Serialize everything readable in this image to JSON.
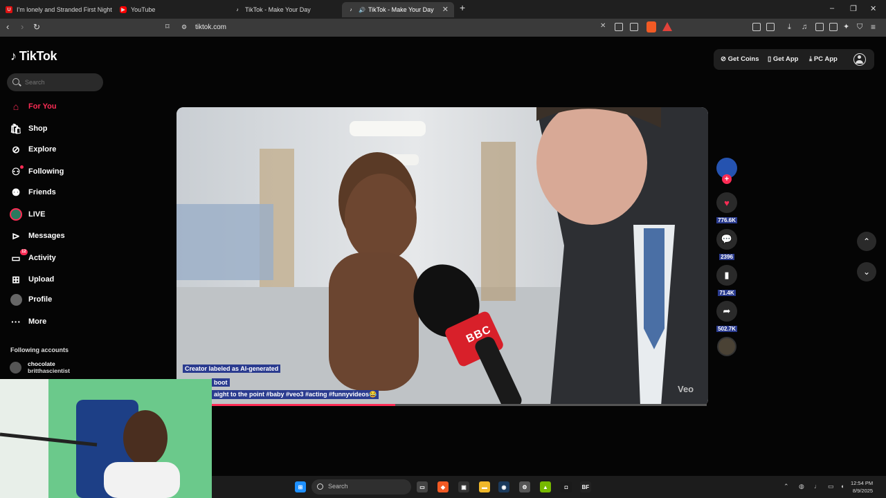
{
  "browser": {
    "tabs": [
      {
        "title": "I'm lonely and Stranded First Night V",
        "favicon": "u-icon"
      },
      {
        "title": "YouTube",
        "favicon": "youtube-icon"
      },
      {
        "title": "TikTok - Make Your Day",
        "favicon": "tiktok-icon"
      },
      {
        "title": "TikTok - Make Your Day",
        "favicon": "tiktok-icon",
        "active": true,
        "audio": true
      }
    ],
    "url": "tiktok.com"
  },
  "tiktok": {
    "brand": "TikTok",
    "search_placeholder": "Search",
    "nav": [
      {
        "label": "For You",
        "icon": "home-icon",
        "active": true
      },
      {
        "label": "Shop",
        "icon": "shop-icon"
      },
      {
        "label": "Explore",
        "icon": "compass-icon"
      },
      {
        "label": "Following",
        "icon": "following-icon"
      },
      {
        "label": "Friends",
        "icon": "friends-icon"
      },
      {
        "label": "LIVE",
        "icon": "live-icon"
      },
      {
        "label": "Messages",
        "icon": "messages-icon"
      },
      {
        "label": "Activity",
        "icon": "activity-icon",
        "badge": "12"
      },
      {
        "label": "Upload",
        "icon": "upload-icon"
      },
      {
        "label": "Profile",
        "icon": "profile-icon"
      },
      {
        "label": "More",
        "icon": "more-icon"
      }
    ],
    "following_header": "Following accounts",
    "following_account": {
      "name": "chocolate",
      "handle": "britthascientist"
    },
    "top_buttons": {
      "coins": "Get Coins",
      "app": "Get App",
      "pc": "PC App"
    },
    "video": {
      "ai_label": "Creator labeled as AI-generated",
      "author": "boot",
      "caption": "aight to the  point #baby  #veo3  #acting  #funnyvideos😂",
      "watermark": "Veo",
      "mic_logo": "BBC",
      "progress": 0.37
    },
    "actions": {
      "likes": "776.6K",
      "comments": "2396",
      "saves": "71.4K",
      "shares": "502.7K"
    }
  },
  "taskbar": {
    "search": "Search",
    "time": "12:54 PM",
    "date": "8/9/2025"
  },
  "colors": {
    "accent": "#fe2c55",
    "label_bg": "#2a3b8f"
  }
}
